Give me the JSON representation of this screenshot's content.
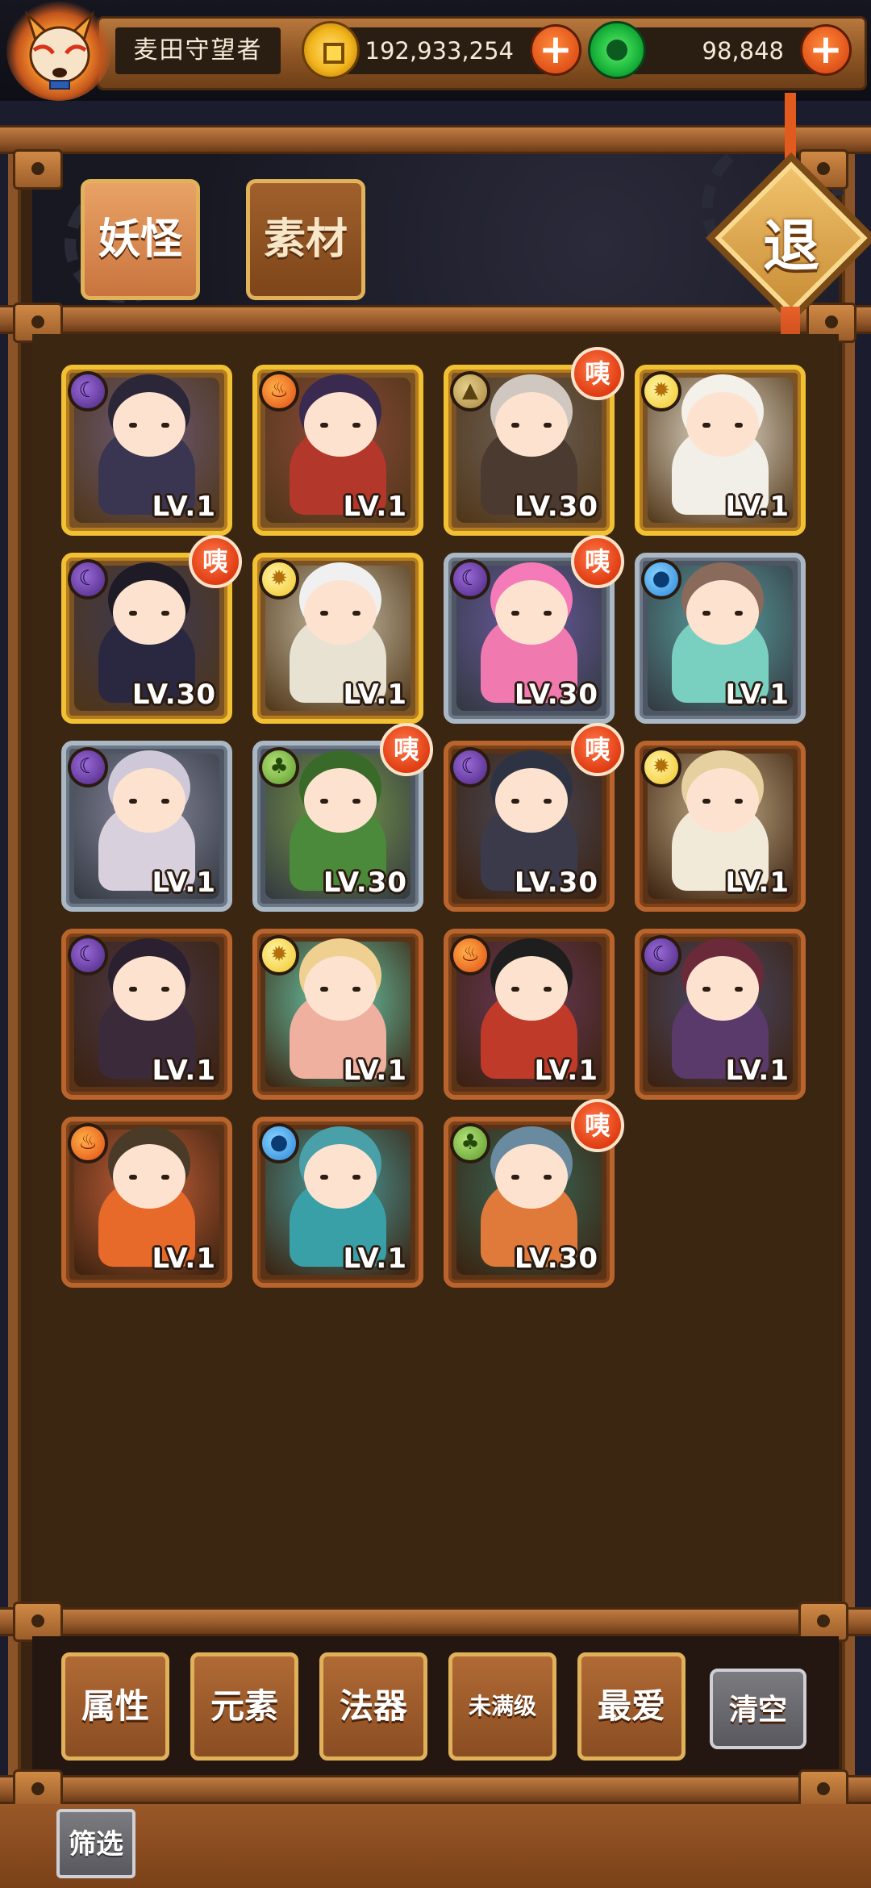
{
  "player": {
    "name": "麦田守望者"
  },
  "currency": {
    "coins": "192,933,254",
    "gems": "98,848"
  },
  "tabs": [
    {
      "label": "妖怪",
      "active": true
    },
    {
      "label": "素材",
      "active": false
    }
  ],
  "exit_label": "退",
  "badge_label": "咦",
  "monsters": [
    {
      "element": "dark",
      "element_icon": "moon-icon",
      "rarity": "gold",
      "level": "LV.1",
      "badge": false
    },
    {
      "element": "fire",
      "element_icon": "fire-icon",
      "rarity": "gold",
      "level": "LV.1",
      "badge": false
    },
    {
      "element": "earth",
      "element_icon": "mountain-icon",
      "rarity": "gold",
      "level": "LV.30",
      "badge": true
    },
    {
      "element": "light",
      "element_icon": "sun-icon",
      "rarity": "gold",
      "level": "LV.1",
      "badge": false
    },
    {
      "element": "dark",
      "element_icon": "moon-icon",
      "rarity": "gold",
      "level": "LV.30",
      "badge": true
    },
    {
      "element": "light",
      "element_icon": "sun-icon",
      "rarity": "gold",
      "level": "LV.1",
      "badge": false
    },
    {
      "element": "dark",
      "element_icon": "moon-icon",
      "rarity": "silver",
      "level": "LV.30",
      "badge": true
    },
    {
      "element": "water",
      "element_icon": "water-drop-icon",
      "rarity": "silver",
      "level": "LV.1",
      "badge": false
    },
    {
      "element": "dark",
      "element_icon": "moon-icon",
      "rarity": "silver",
      "level": "LV.1",
      "badge": false
    },
    {
      "element": "wood",
      "element_icon": "leaf-icon",
      "rarity": "silver",
      "level": "LV.30",
      "badge": true
    },
    {
      "element": "dark",
      "element_icon": "moon-icon",
      "rarity": "bronze",
      "level": "LV.30",
      "badge": true
    },
    {
      "element": "light",
      "element_icon": "sun-icon",
      "rarity": "bronze",
      "level": "LV.1",
      "badge": false
    },
    {
      "element": "dark",
      "element_icon": "moon-icon",
      "rarity": "bronze",
      "level": "LV.1",
      "badge": false
    },
    {
      "element": "light",
      "element_icon": "sun-icon",
      "rarity": "bronze",
      "level": "LV.1",
      "badge": false
    },
    {
      "element": "fire",
      "element_icon": "fire-icon",
      "rarity": "bronze",
      "level": "LV.1",
      "badge": false
    },
    {
      "element": "dark",
      "element_icon": "moon-icon",
      "rarity": "bronze",
      "level": "LV.1",
      "badge": false
    },
    {
      "element": "fire",
      "element_icon": "fire-icon",
      "rarity": "bronze",
      "level": "LV.1",
      "badge": false
    },
    {
      "element": "water",
      "element_icon": "water-drop-icon",
      "rarity": "bronze",
      "level": "LV.1",
      "badge": false
    },
    {
      "element": "wood",
      "element_icon": "leaf-icon",
      "rarity": "bronze",
      "level": "LV.30",
      "badge": true
    }
  ],
  "filters": {
    "attribute": "属性",
    "element": "元素",
    "artifact": "法器",
    "not_max_level": "未满级",
    "favorite": "最爱",
    "clear": "清空"
  },
  "filter_toggle": "筛选"
}
